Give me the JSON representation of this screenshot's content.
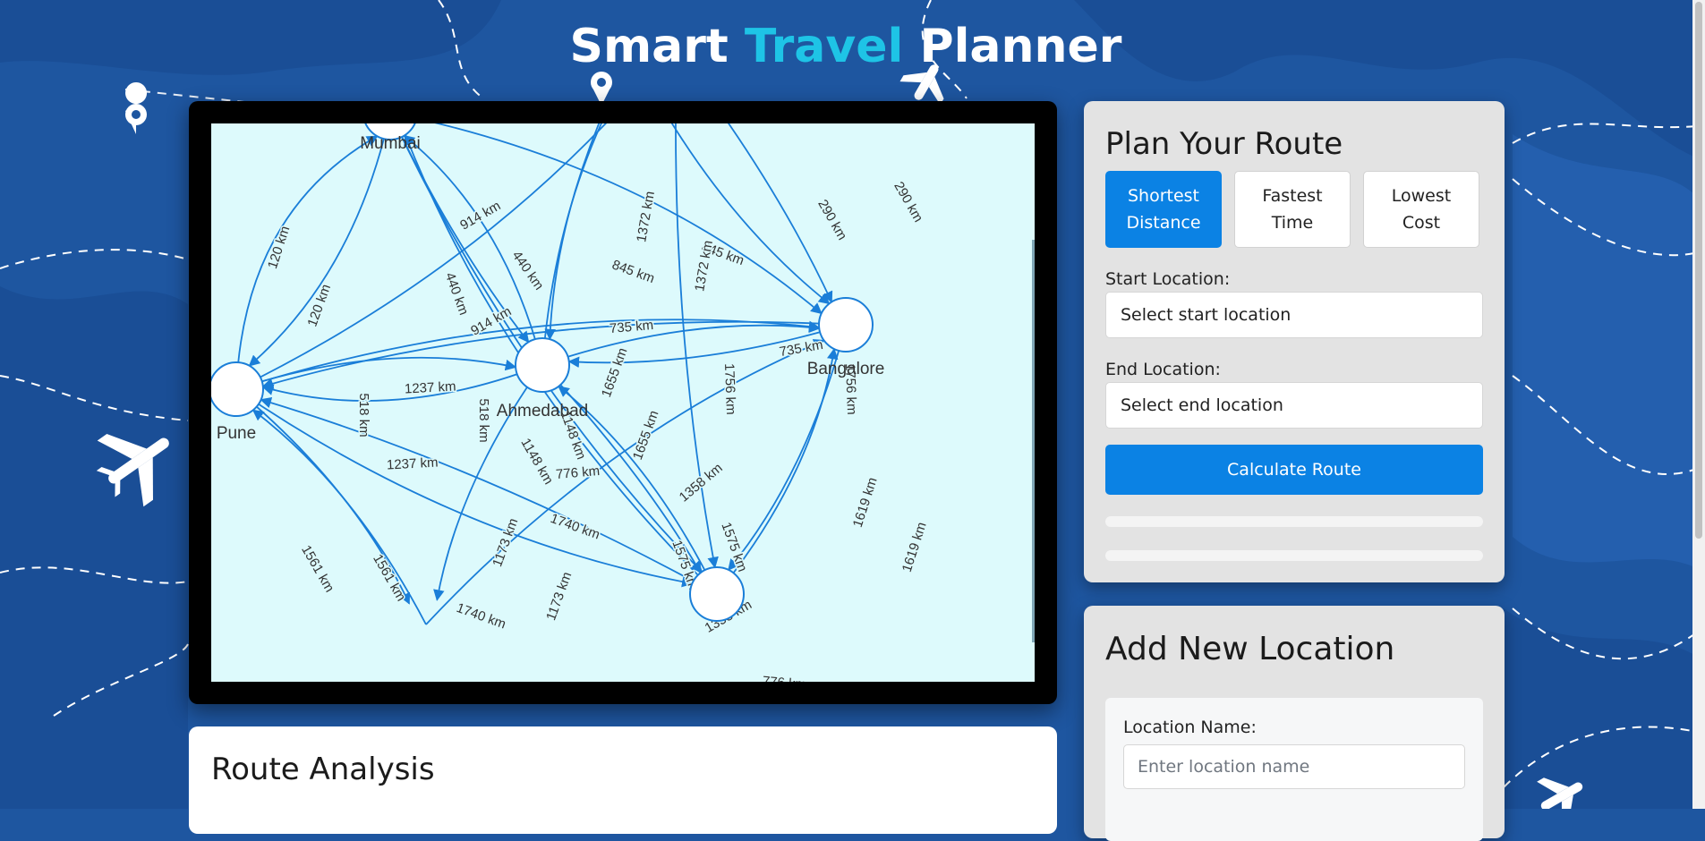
{
  "header": {
    "title_part1": "Smart ",
    "title_accent": "Travel",
    "title_part2": " Planner"
  },
  "colors": {
    "background": "#1e56a0",
    "accent_text": "#1ec4e6",
    "primary_button": "#0b82e4",
    "map_background": "#ddfafc",
    "edge": "#1a7ed8"
  },
  "map": {
    "nodes": [
      {
        "id": "mumbai",
        "label": "Mumbai"
      },
      {
        "id": "pune",
        "label": "Pune"
      },
      {
        "id": "ahmedabad",
        "label": "Ahmedabad"
      },
      {
        "id": "bangalore",
        "label": "Bangalore"
      },
      {
        "id": "bottom",
        "label": ""
      }
    ],
    "edge_labels": [
      "120 km",
      "120 km",
      "914 km",
      "914 km",
      "440 km",
      "440 km",
      "845 km",
      "845 km",
      "290 km",
      "290 km",
      "1372 km",
      "1372 km",
      "735 km",
      "735 km",
      "1237 km",
      "1237 km",
      "518 km",
      "518 km",
      "1148 km",
      "1148 km",
      "1655 km",
      "1655 km",
      "1756 km",
      "1756 km",
      "1358 km",
      "1358 km",
      "1740 km",
      "1740 km",
      "1575 km",
      "1575 km",
      "1619 km",
      "1619 km",
      "1561 km",
      "1561 km",
      "1173 km",
      "1173 km",
      "776 km",
      "776 km"
    ]
  },
  "route_analysis": {
    "title": "Route Analysis"
  },
  "plan": {
    "title": "Plan Your Route",
    "options": [
      {
        "line1": "Shortest",
        "line2": "Distance",
        "active": true
      },
      {
        "line1": "Fastest",
        "line2": "Time",
        "active": false
      },
      {
        "line1": "Lowest",
        "line2": "Cost",
        "active": false
      }
    ],
    "start_label": "Start Location:",
    "start_value": "Select start location",
    "end_label": "End Location:",
    "end_value": "Select end location",
    "calculate_label": "Calculate Route"
  },
  "add_location": {
    "title": "Add New Location",
    "name_label": "Location Name:",
    "name_placeholder": "Enter location name"
  }
}
